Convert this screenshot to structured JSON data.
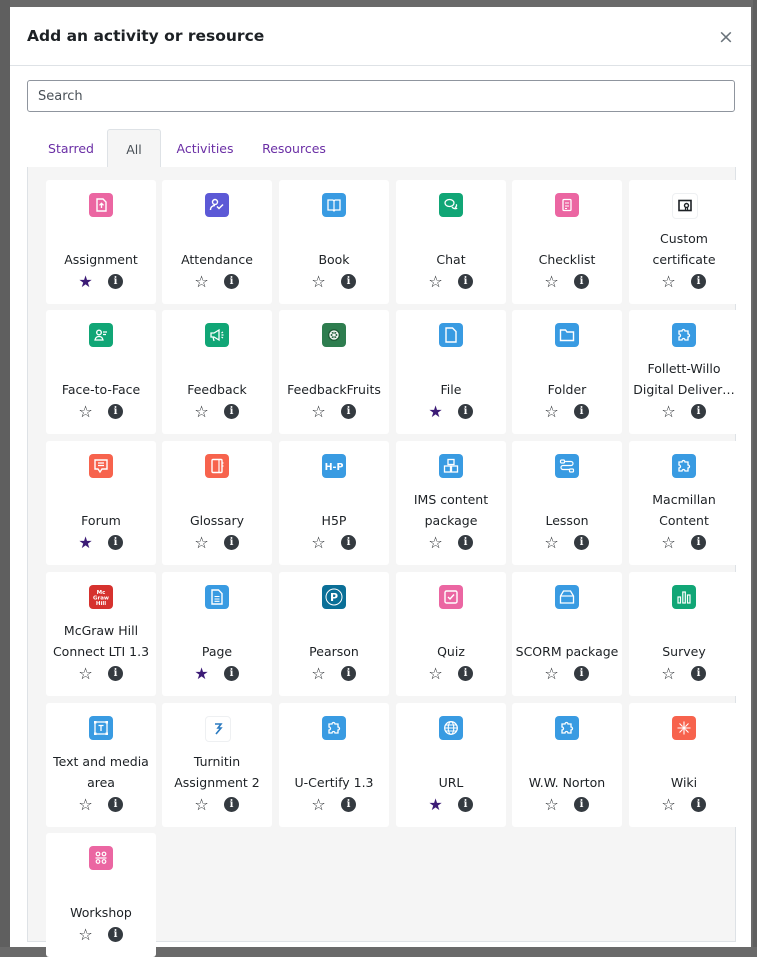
{
  "modal": {
    "title": "Add an activity or resource",
    "close_glyph": "×"
  },
  "search": {
    "placeholder": "Search",
    "value": ""
  },
  "tabs": [
    {
      "label": "Starred",
      "active": false
    },
    {
      "label": "All",
      "active": true
    },
    {
      "label": "Activities",
      "active": false
    },
    {
      "label": "Resources",
      "active": false
    }
  ],
  "items": [
    {
      "name": "Assignment",
      "icon": "assignment-icon",
      "color": "#eb66a2",
      "starred": true
    },
    {
      "name": "Attendance",
      "icon": "attendance-icon",
      "color": "#5c59d6",
      "starred": false
    },
    {
      "name": "Book",
      "icon": "book-icon",
      "color": "#399be2",
      "starred": false
    },
    {
      "name": "Chat",
      "icon": "chat-icon",
      "color": "#11a676",
      "starred": false
    },
    {
      "name": "Checklist",
      "icon": "checklist-icon",
      "color": "#eb66a2",
      "starred": false
    },
    {
      "name": "Custom certificate",
      "icon": "certificate-icon",
      "color": "#ffffff",
      "starred": false
    },
    {
      "name": "Face-to-Face",
      "icon": "face-to-face-icon",
      "color": "#11a676",
      "starred": false
    },
    {
      "name": "Feedback",
      "icon": "feedback-icon",
      "color": "#11a676",
      "starred": false
    },
    {
      "name": "FeedbackFruits",
      "icon": "feedbackfruits-icon",
      "color": "#2e7d4f",
      "starred": false
    },
    {
      "name": "File",
      "icon": "file-icon",
      "color": "#399be2",
      "starred": true
    },
    {
      "name": "Folder",
      "icon": "folder-icon",
      "color": "#399be2",
      "starred": false
    },
    {
      "name": "Follett-Willo Digital Deliver…",
      "icon": "puzzle-icon",
      "color": "#399be2",
      "starred": false
    },
    {
      "name": "Forum",
      "icon": "forum-icon",
      "color": "#f7634d",
      "starred": true
    },
    {
      "name": "Glossary",
      "icon": "glossary-icon",
      "color": "#f7634d",
      "starred": false
    },
    {
      "name": "H5P",
      "icon": "h5p-icon",
      "color": "#399be2",
      "starred": false
    },
    {
      "name": "IMS content package",
      "icon": "ims-package-icon",
      "color": "#399be2",
      "starred": false
    },
    {
      "name": "Lesson",
      "icon": "lesson-icon",
      "color": "#399be2",
      "starred": false
    },
    {
      "name": "Macmillan Content",
      "icon": "puzzle-icon",
      "color": "#399be2",
      "starred": false
    },
    {
      "name": "McGraw Hill Connect LTI 1.3",
      "icon": "mcgraw-hill-icon",
      "color": "#d6322e",
      "starred": false
    },
    {
      "name": "Page",
      "icon": "page-icon",
      "color": "#399be2",
      "starred": true
    },
    {
      "name": "Pearson",
      "icon": "pearson-icon",
      "color": "#0a6f97",
      "starred": false
    },
    {
      "name": "Quiz",
      "icon": "quiz-icon",
      "color": "#eb66a2",
      "starred": false
    },
    {
      "name": "SCORM package",
      "icon": "scorm-icon",
      "color": "#399be2",
      "starred": false
    },
    {
      "name": "Survey",
      "icon": "survey-icon",
      "color": "#11a676",
      "starred": false
    },
    {
      "name": "Text and media area",
      "icon": "text-media-icon",
      "color": "#399be2",
      "starred": false
    },
    {
      "name": "Turnitin Assignment 2",
      "icon": "turnitin-icon",
      "color": "#ffffff",
      "starred": false
    },
    {
      "name": "U-Certify 1.3",
      "icon": "puzzle-icon",
      "color": "#399be2",
      "starred": false
    },
    {
      "name": "URL",
      "icon": "url-globe-icon",
      "color": "#399be2",
      "starred": true
    },
    {
      "name": "W.W. Norton",
      "icon": "puzzle-icon",
      "color": "#399be2",
      "starred": false
    },
    {
      "name": "Wiki",
      "icon": "wiki-icon",
      "color": "#f7634d",
      "starred": false
    },
    {
      "name": "Workshop",
      "icon": "workshop-icon",
      "color": "#eb66a2",
      "starred": false
    }
  ],
  "glyphs": {
    "star_on": "★",
    "star_off": "☆",
    "info": "i"
  }
}
